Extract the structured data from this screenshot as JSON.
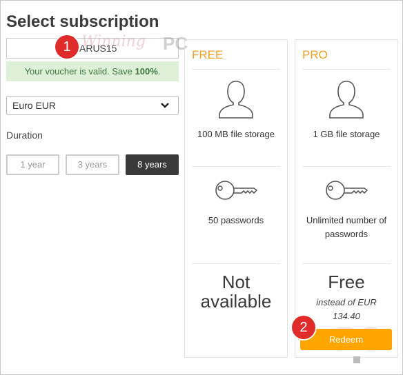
{
  "page": {
    "title": "Select subscription"
  },
  "voucher": {
    "value": "ARUS15",
    "valid_prefix": "Your voucher is valid. Save ",
    "valid_amount": "100%",
    "valid_suffix": "."
  },
  "currency": {
    "selected": "Euro EUR"
  },
  "duration": {
    "label": "Duration",
    "options": [
      "1 year",
      "3 years",
      "8 years"
    ],
    "selected": "8 years"
  },
  "plans": [
    {
      "name": "FREE",
      "storage": "100 MB file storage",
      "passwords": "50 passwords",
      "price": "Not available",
      "price_line1": "Not",
      "price_line2": "available"
    },
    {
      "name": "PRO",
      "storage": "1 GB file storage",
      "passwords_line1": "Unlimited number of",
      "passwords_line2": "passwords",
      "price": "Free",
      "instead_line1": "instead of EUR",
      "instead_line2": "134.40",
      "button": "Redeem"
    }
  ],
  "annotations": {
    "step1": "1",
    "step2": "2",
    "watermark_text": "Winning",
    "watermark_pc": "PC",
    "corner_mark": "PC"
  },
  "colors": {
    "accent": "#f0a020",
    "button": "#ffa500",
    "valid_bg": "#dff0d8",
    "valid_text": "#3c763d",
    "badge": "#e02b2b",
    "active_duration": "#3a3a3a"
  }
}
